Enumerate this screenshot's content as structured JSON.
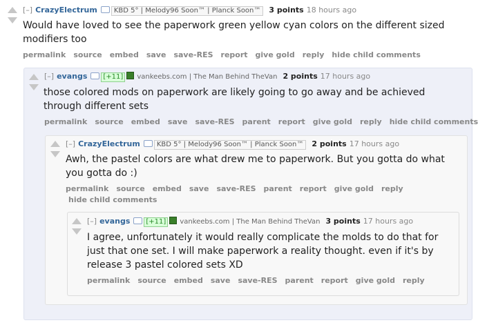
{
  "buttons_full": [
    "permalink",
    "source",
    "embed",
    "save",
    "save-RES",
    "report",
    "give gold",
    "reply",
    "hide child comments"
  ],
  "buttons_child": [
    "permalink",
    "source",
    "embed",
    "save",
    "save-RES",
    "parent",
    "report",
    "give gold",
    "reply",
    "hide child comments"
  ],
  "buttons_leaf": [
    "permalink",
    "source",
    "embed",
    "save",
    "save-RES",
    "parent",
    "report",
    "give gold",
    "reply"
  ],
  "comments": [
    {
      "collapse": "[–]",
      "author": "CrazyElectrum",
      "flair_text": "KBD 5° | Melody96 Soon™ | Planck Soon™",
      "score": "3 points",
      "time": "18 hours ago",
      "body": "Would have loved to see the paperwork green yellow cyan colors on the different sized modifiers too"
    },
    {
      "collapse": "[–]",
      "author": "evangs",
      "plus": "[+11]",
      "flair_text": "vankeebs.com | The Man Behind TheVan",
      "score": "2 points",
      "time": "17 hours ago",
      "body": "those colored mods on paperwork are likely going to go away and be achieved through different sets"
    },
    {
      "collapse": "[–]",
      "author": "CrazyElectrum",
      "flair_text": "KBD 5° | Melody96 Soon™ | Planck Soon™",
      "score": "2 points",
      "time": "17 hours ago",
      "body": "Awh, the pastel colors are what drew me to paperwork. But you gotta do what you gotta do :)"
    },
    {
      "collapse": "[–]",
      "author": "evangs",
      "plus": "[+11]",
      "flair_text": "vankeebs.com | The Man Behind TheVan",
      "score": "3 points",
      "time": "17 hours ago",
      "body": "I agree, unfortunately it would really complicate the molds to do that for just that one set. I will make paperwork a reality thought. even if it's by release 3 pastel colored sets XD"
    }
  ]
}
